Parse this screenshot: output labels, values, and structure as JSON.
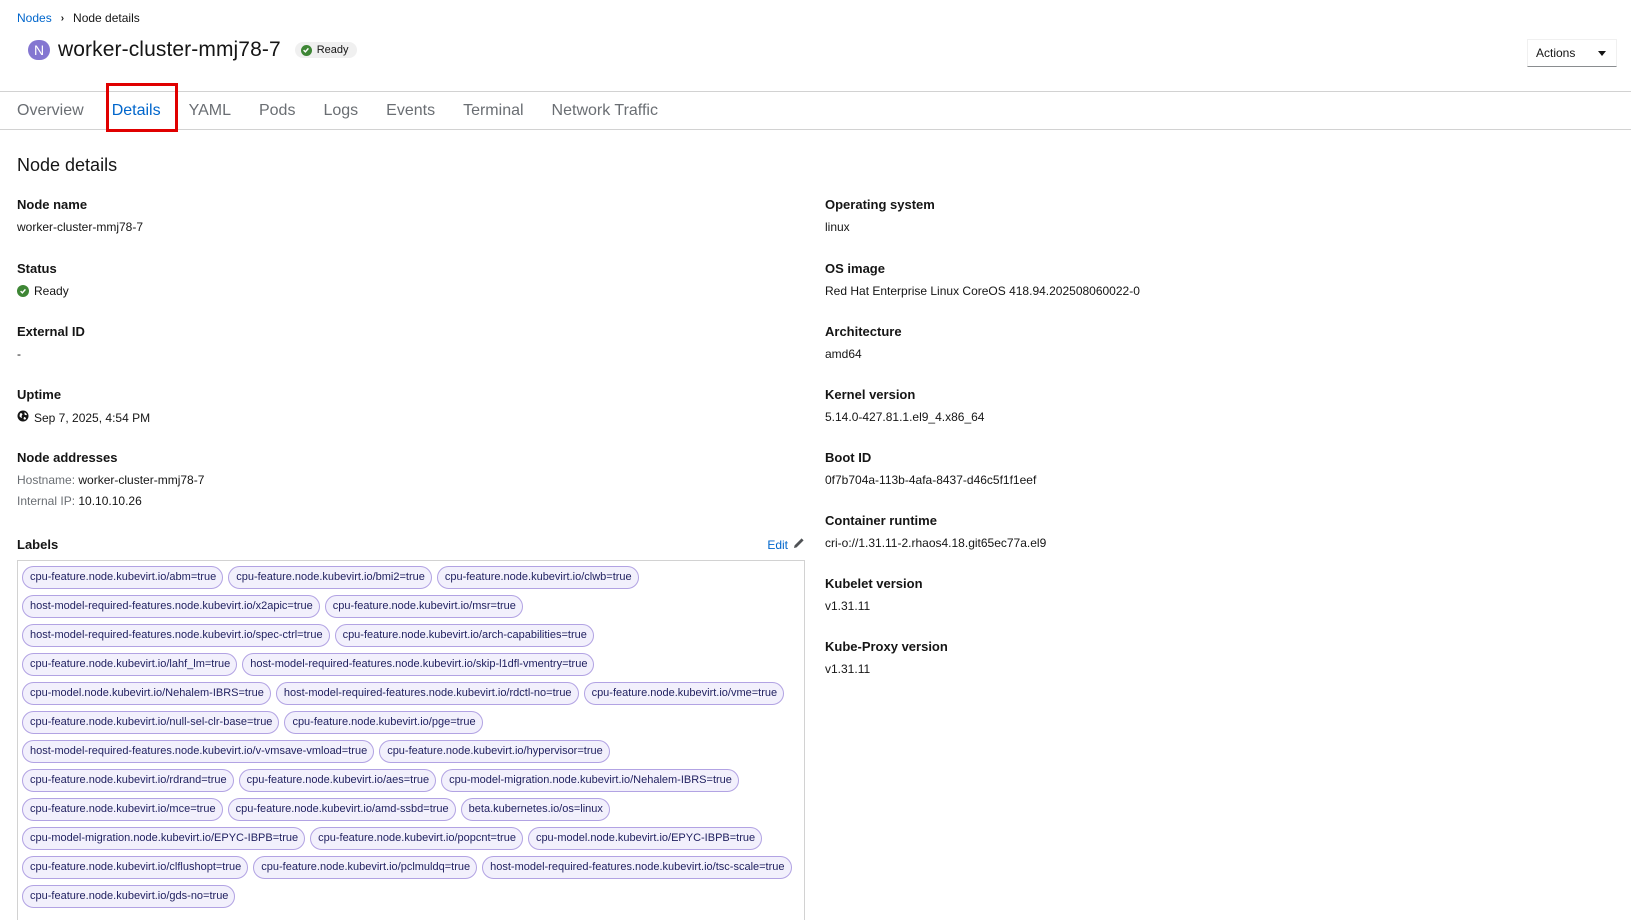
{
  "breadcrumb": {
    "parent": "Nodes",
    "current": "Node details"
  },
  "header": {
    "badge": "N",
    "title": "worker-cluster-mmj78-7",
    "status": "Ready",
    "actions_label": "Actions"
  },
  "tabs": [
    "Overview",
    "Details",
    "YAML",
    "Pods",
    "Logs",
    "Events",
    "Terminal",
    "Network Traffic"
  ],
  "active_tab": "Details",
  "section_title": "Node details",
  "left": {
    "node_name": {
      "label": "Node name",
      "value": "worker-cluster-mmj78-7"
    },
    "status": {
      "label": "Status",
      "value": "Ready"
    },
    "external_id": {
      "label": "External ID",
      "value": "-"
    },
    "uptime": {
      "label": "Uptime",
      "value": "Sep 7, 2025, 4:54 PM"
    },
    "addresses": {
      "label": "Node addresses",
      "hostname_key": "Hostname:",
      "hostname_value": "worker-cluster-mmj78-7",
      "ip_key": "Internal IP:",
      "ip_value": "10.10.10.26"
    },
    "labels": {
      "label": "Labels",
      "edit": "Edit"
    }
  },
  "right": {
    "os": {
      "label": "Operating system",
      "value": "linux"
    },
    "os_image": {
      "label": "OS image",
      "value": "Red Hat Enterprise Linux CoreOS 418.94.202508060022-0"
    },
    "arch": {
      "label": "Architecture",
      "value": "amd64"
    },
    "kernel": {
      "label": "Kernel version",
      "value": "5.14.0-427.81.1.el9_4.x86_64"
    },
    "boot_id": {
      "label": "Boot ID",
      "value": "0f7b704a-113b-4afa-8437-d46c5f1f1eef"
    },
    "runtime": {
      "label": "Container runtime",
      "value": "cri-o://1.31.11-2.rhaos4.18.git65ec77a.el9"
    },
    "kubelet": {
      "label": "Kubelet version",
      "value": "v1.31.11"
    },
    "kubeproxy": {
      "label": "Kube-Proxy version",
      "value": "v1.31.11"
    }
  },
  "label_chips": [
    "cpu-feature.node.kubevirt.io/abm=true",
    "cpu-feature.node.kubevirt.io/bmi2=true",
    "cpu-feature.node.kubevirt.io/clwb=true",
    "host-model-required-features.node.kubevirt.io/x2apic=true",
    "cpu-feature.node.kubevirt.io/msr=true",
    "host-model-required-features.node.kubevirt.io/spec-ctrl=true",
    "cpu-feature.node.kubevirt.io/arch-capabilities=true",
    "cpu-feature.node.kubevirt.io/lahf_lm=true",
    "host-model-required-features.node.kubevirt.io/skip-l1dfl-vmentry=true",
    "cpu-model.node.kubevirt.io/Nehalem-IBRS=true",
    "host-model-required-features.node.kubevirt.io/rdctl-no=true",
    "cpu-feature.node.kubevirt.io/vme=true",
    "cpu-feature.node.kubevirt.io/null-sel-clr-base=true",
    "cpu-feature.node.kubevirt.io/pge=true",
    "host-model-required-features.node.kubevirt.io/v-vmsave-vmload=true",
    "cpu-feature.node.kubevirt.io/hypervisor=true",
    "cpu-feature.node.kubevirt.io/rdrand=true",
    "cpu-feature.node.kubevirt.io/aes=true",
    "cpu-model-migration.node.kubevirt.io/Nehalem-IBRS=true",
    "cpu-feature.node.kubevirt.io/mce=true",
    "cpu-feature.node.kubevirt.io/amd-ssbd=true",
    "beta.kubernetes.io/os=linux",
    "cpu-model-migration.node.kubevirt.io/EPYC-IBPB=true",
    "cpu-feature.node.kubevirt.io/popcnt=true",
    "cpu-model.node.kubevirt.io/EPYC-IBPB=true",
    "cpu-feature.node.kubevirt.io/clflushopt=true",
    "cpu-feature.node.kubevirt.io/pclmuldq=true",
    "host-model-required-features.node.kubevirt.io/tsc-scale=true",
    "cpu-feature.node.kubevirt.io/gds-no=true"
  ]
}
